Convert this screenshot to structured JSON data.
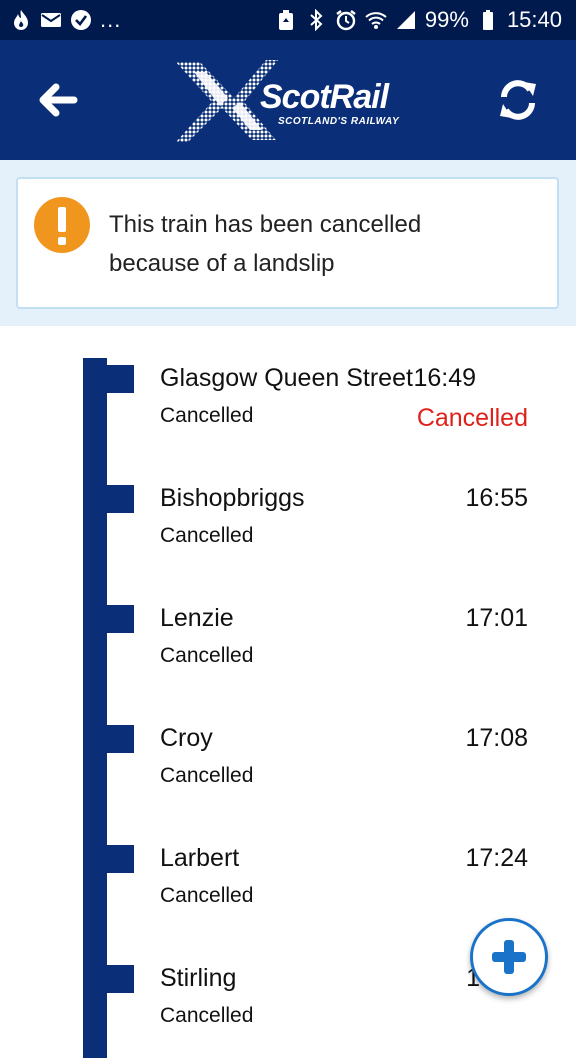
{
  "status_bar": {
    "left_icons": [
      "fire-icon",
      "mail-icon",
      "check-circle-icon"
    ],
    "more": "...",
    "right_icons": [
      "recycle-icon",
      "bluetooth-icon",
      "alarm-icon",
      "wifi-icon",
      "signal-icon",
      "battery-icon"
    ],
    "battery": "99%",
    "time": "15:40"
  },
  "header": {
    "brand_name": "ScotRail",
    "brand_tagline": "SCOTLAND'S RAILWAY",
    "back_icon": "arrow-left-icon",
    "refresh_icon": "refresh-icon"
  },
  "alert": {
    "icon": "exclamation-icon",
    "line1": "This train has been cancelled",
    "line2": "because of a landslip"
  },
  "stops": [
    {
      "name": "Glasgow Queen Street",
      "status": "Cancelled",
      "time": "16:49",
      "time_status": "Cancelled"
    },
    {
      "name": "Bishopbriggs",
      "status": "Cancelled",
      "time": "16:55"
    },
    {
      "name": "Lenzie",
      "status": "Cancelled",
      "time": "17:01"
    },
    {
      "name": "Croy",
      "status": "Cancelled",
      "time": "17:08"
    },
    {
      "name": "Larbert",
      "status": "Cancelled",
      "time": "17:24"
    },
    {
      "name": "Stirling",
      "status": "Cancelled",
      "time": "1"
    }
  ],
  "fab": {
    "icon": "plus-icon"
  },
  "colors": {
    "status_bar": "#001a4d",
    "brand_navy": "#0a2f78",
    "alert_bg": "#e4f1fa",
    "warning_orange": "#f0961e",
    "cancelled_red": "#e0201b",
    "fab_blue": "#1a73c8"
  }
}
